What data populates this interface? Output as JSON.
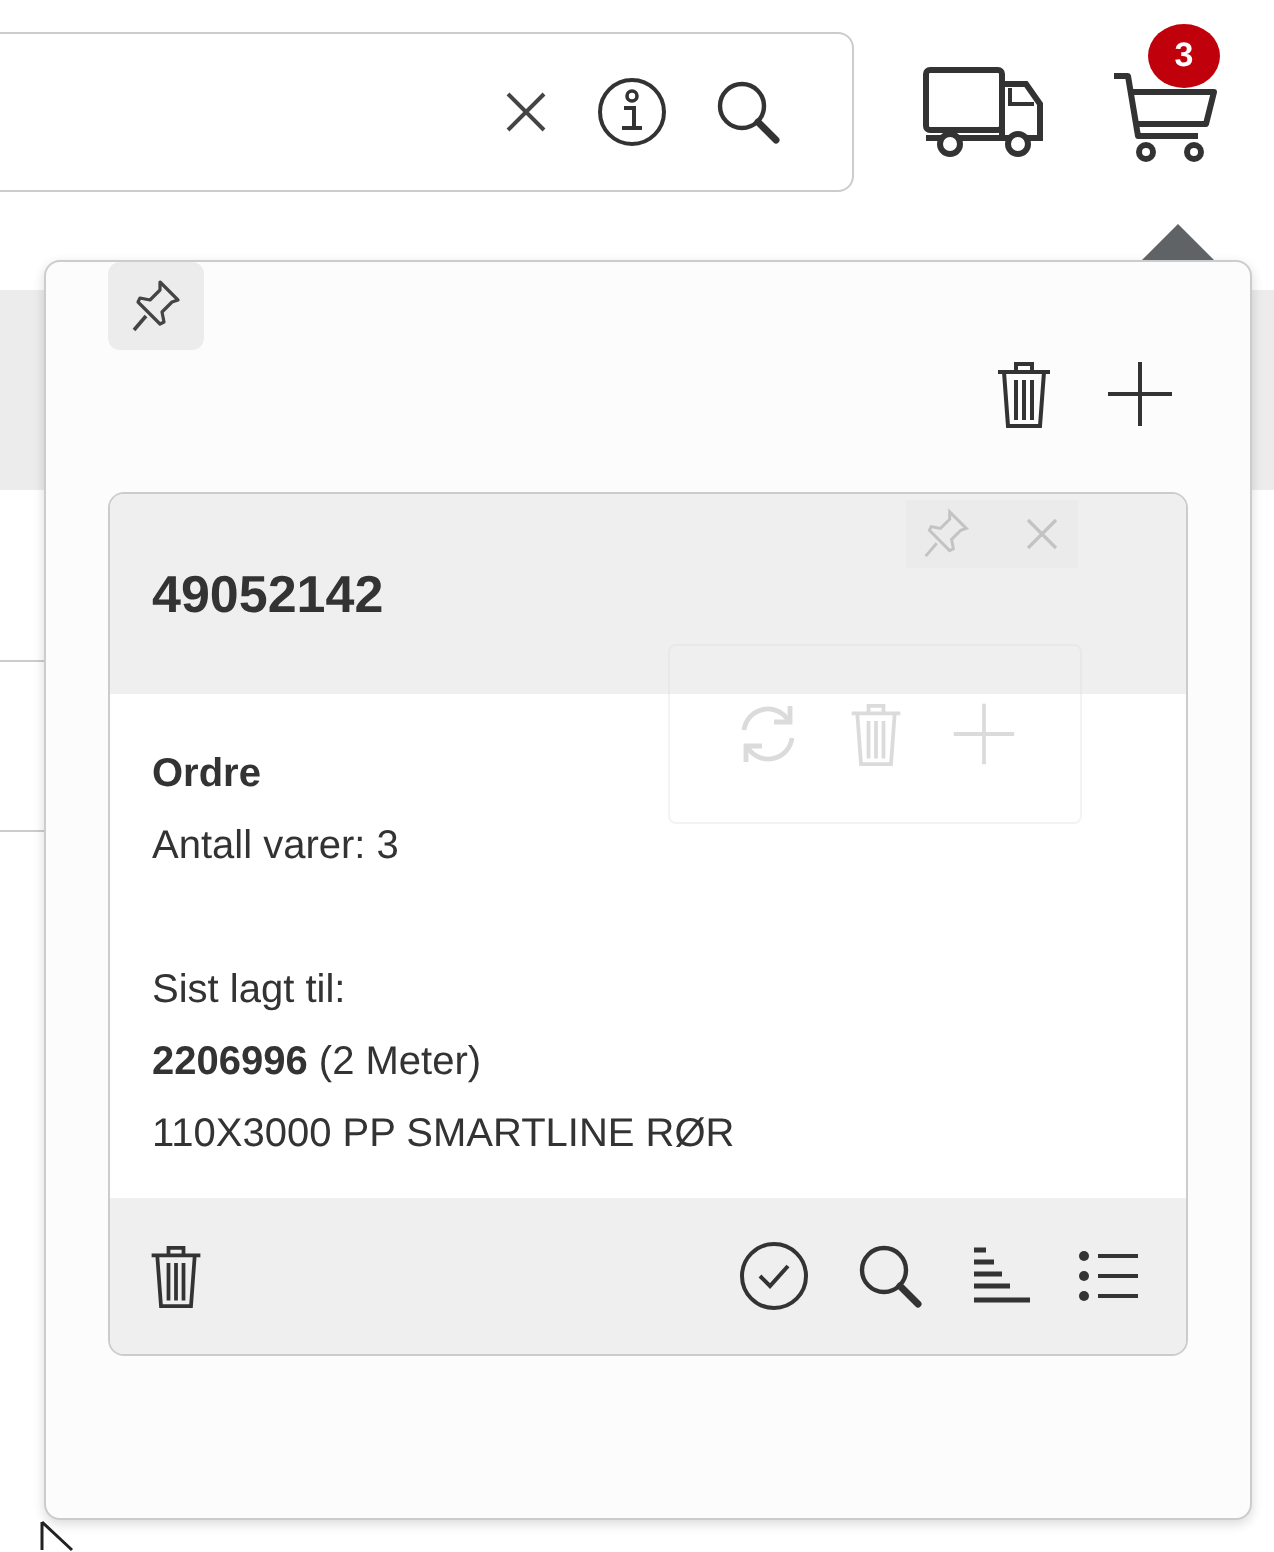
{
  "cart": {
    "badge": "3"
  },
  "cart_popup": {
    "card": {
      "title": "49052142",
      "type": "Ordre",
      "item_count": "Antall varer: 3",
      "last_added_label": "Sist lagt til:",
      "last_added": "**2206996** (2 Meter)",
      "description": "110X3000 PP SMARTLINE RØR"
    }
  }
}
